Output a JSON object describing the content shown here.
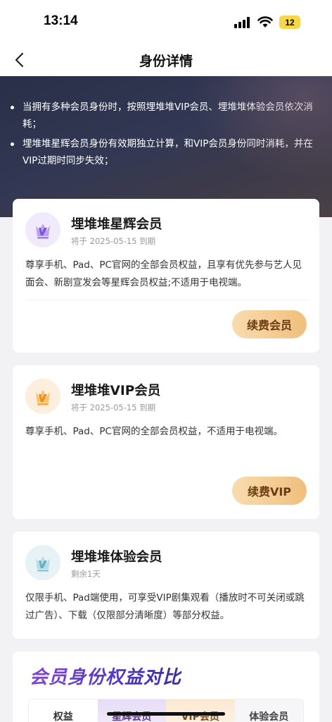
{
  "status_bar": {
    "time": "13:14",
    "battery": "12"
  },
  "header": {
    "title": "身份详情"
  },
  "notes": [
    "当拥有多种会员身份时，按照埋堆堆VIP会员、埋堆堆体验会员依次消耗；",
    "埋堆堆星辉会员身份有效期独立计算，和VIP会员身份同时消耗，并在VIP过期时同步失效；"
  ],
  "cards": [
    {
      "title": "埋堆堆星辉会员",
      "expiry": "将于 2025-05-15 到期",
      "description": "尊享手机、Pad、PC官网的全部会员权益，且享有优先参与艺人见面会、新剧宣发会等星辉会员权益;不适用于电视端。",
      "button": "续费会员",
      "icon": "star-crown-icon",
      "icon_color": "#7d4fd8"
    },
    {
      "title": "埋堆堆VIP会员",
      "expiry": "将于 2025-05-15 到期",
      "description": "尊享手机、Pad、PC官网的全部会员权益，不适用于电视端。",
      "button": "续费VIP",
      "icon": "vip-crown-icon",
      "icon_color": "#f08a1c"
    },
    {
      "title": "埋堆堆体验会员",
      "expiry": "剩余1天",
      "description": "仅限手机、Pad端使用，可享受VIP剧集观看（播放时不可关闭或跳过广告）、下载（仅限部分清晰度）等部分权益。",
      "icon": "trial-crown-icon",
      "icon_color": "#5fb0c9"
    }
  ],
  "compare": {
    "title": "会员身份权益对比",
    "columns": [
      "权益",
      "星辉会员",
      "VIP会员",
      "体验会员"
    ]
  }
}
